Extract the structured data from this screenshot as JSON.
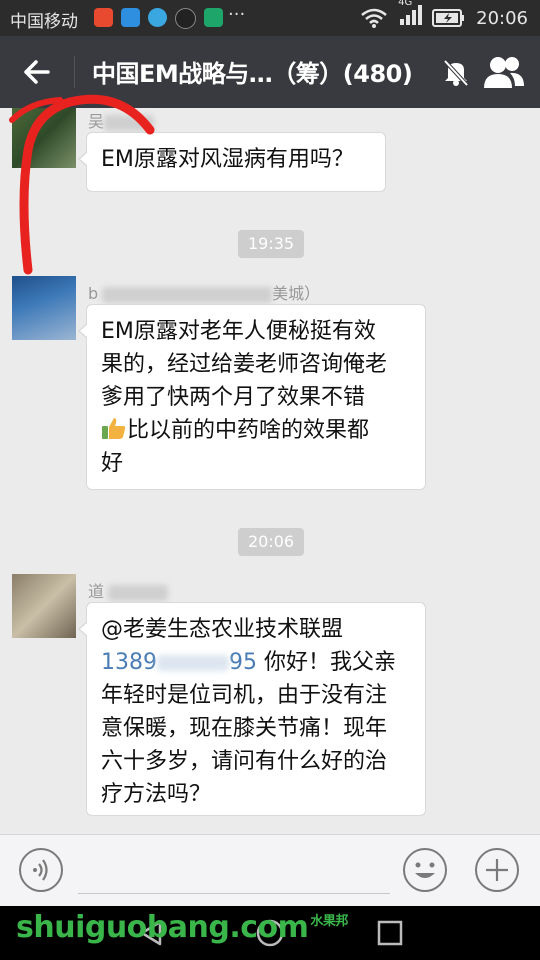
{
  "status_bar": {
    "carrier": "中国移动",
    "more": "···",
    "network": "4G",
    "time": "20:06"
  },
  "header": {
    "title": "中国EM战略与…（筹）(480)",
    "back_icon": "back-arrow-icon",
    "mute_icon": "mute-bell-icon",
    "members_icon": "group-members-icon"
  },
  "messages": [
    {
      "type": "text",
      "sender_partial": "吴",
      "text": "EM原露对风湿病有用吗？"
    },
    {
      "type": "time",
      "text": "19:35"
    },
    {
      "type": "text",
      "sender_partial": "b",
      "sender_suffix": "美城）",
      "lines": [
        "EM原露对老年人便秘挺有效",
        "果的，经过给姜老师咨询俺老",
        "爹用了快两个月了效果不错",
        "比以前的中药啥的效果都",
        "好"
      ],
      "emoji": "thumbs-up-icon"
    },
    {
      "type": "time",
      "text": "20:06"
    },
    {
      "type": "text",
      "sender_partial": "道",
      "mention": "@老姜生态农业技术联盟",
      "phone_start": "1389",
      "phone_end": "95",
      "lines": [
        "你好！我父亲",
        "年轻时是位司机，由于没有注",
        "意保暖，现在膝关节痛！现年",
        "六十多岁，请问有什么好的治",
        "疗方法吗？"
      ]
    }
  ],
  "input_bar": {
    "voice_icon": "voice-icon",
    "emoji_icon": "emoji-icon",
    "plus_icon": "plus-icon"
  },
  "watermark": {
    "text": "shuiguobang.com",
    "cn": "水果邦"
  },
  "colors": {
    "header_bg": "#393a3f",
    "chat_bg": "#ebebeb",
    "link": "#4a7db5",
    "watermark": "#3ab54a",
    "annotation": "#e8231f"
  }
}
